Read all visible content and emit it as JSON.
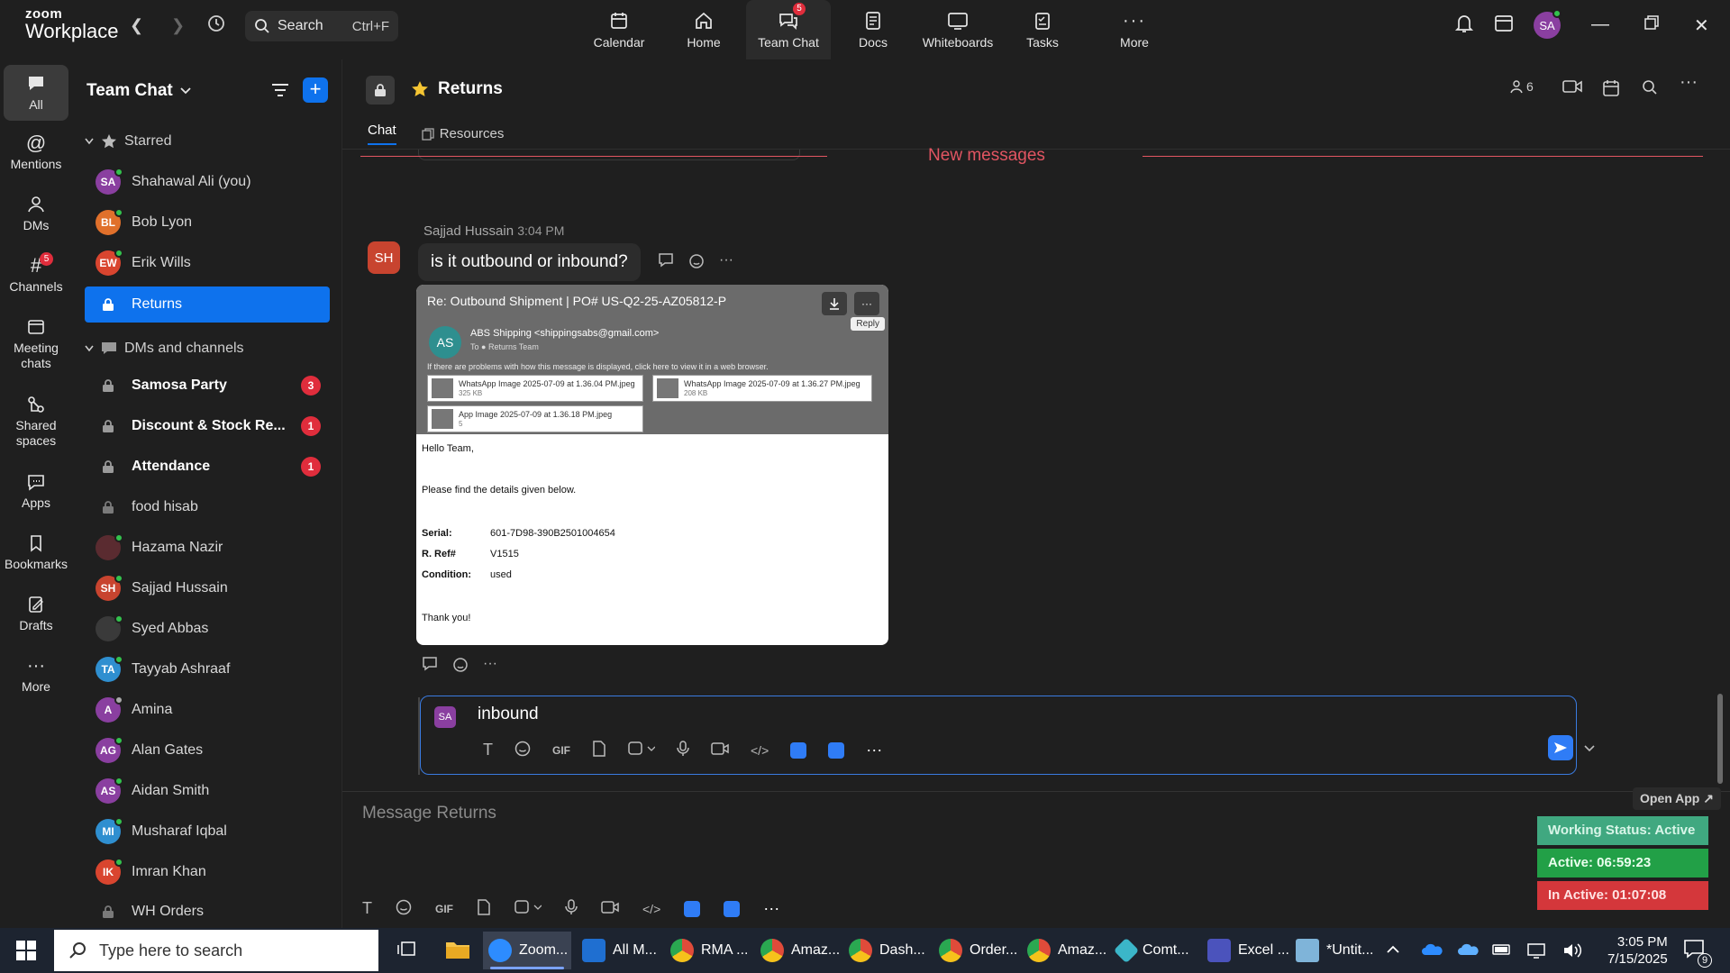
{
  "brand": {
    "line1": "zoom",
    "line2": "Workplace"
  },
  "search": {
    "label": "Search",
    "shortcut": "Ctrl+F"
  },
  "nav": [
    {
      "label": "Calendar",
      "icon": "calendar-icon"
    },
    {
      "label": "Home",
      "icon": "home-icon"
    },
    {
      "label": "Team Chat",
      "icon": "team-chat-icon",
      "badge": "5",
      "active": true
    },
    {
      "label": "Docs",
      "icon": "docs-icon"
    },
    {
      "label": "Whiteboards",
      "icon": "whiteboard-icon"
    },
    {
      "label": "Tasks",
      "icon": "tasks-icon"
    },
    {
      "label": "More",
      "icon": "more-icon"
    }
  ],
  "user": {
    "initials": "SA",
    "status_color": "#33c24d"
  },
  "rail": [
    {
      "label": "All",
      "icon": "chat-bubble-icon",
      "active": true
    },
    {
      "label": "Mentions",
      "icon": "at-icon"
    },
    {
      "label": "DMs",
      "icon": "people-icon"
    },
    {
      "label": "Channels",
      "icon": "hash-icon",
      "badge": "5"
    },
    {
      "label": "Meeting chats",
      "icon": "meeting-chat-icon"
    },
    {
      "label": "Shared spaces",
      "icon": "shared-spaces-icon"
    },
    {
      "label": "Apps",
      "icon": "apps-icon"
    },
    {
      "label": "Bookmarks",
      "icon": "bookmark-icon"
    },
    {
      "label": "Drafts",
      "icon": "drafts-icon"
    },
    {
      "label": "More",
      "icon": "more-icon"
    }
  ],
  "sidebar": {
    "title": "Team Chat",
    "starred_label": "Starred",
    "dms_label": "DMs and channels",
    "starred": [
      {
        "name": "Shahawal Ali (you)",
        "initials": "SA",
        "color": "#8a3fa0",
        "online": true
      },
      {
        "name": "Bob Lyon",
        "initials": "BL",
        "color": "#e0702b",
        "online": true
      },
      {
        "name": "Erik Wills",
        "initials": "EW",
        "color": "#d9452f",
        "online": true
      },
      {
        "name": "Returns",
        "initials": "",
        "lock": true,
        "selected": true
      }
    ],
    "channels": [
      {
        "name": "Samosa Party",
        "lock": true,
        "bold": true,
        "unread": "3"
      },
      {
        "name": "Discount & Stock Re...",
        "lock": true,
        "bold": true,
        "unread": "1"
      },
      {
        "name": "Attendance",
        "lock": true,
        "bold": true,
        "unread": "1"
      },
      {
        "name": "food hisab",
        "lock": true
      },
      {
        "name": "Hazama Nazir",
        "initials": "",
        "color": "#5a2b30",
        "online": true,
        "photo": true
      },
      {
        "name": "Sajjad Hussain",
        "initials": "SH",
        "color": "#c8442f",
        "online": true
      },
      {
        "name": "Syed Abbas",
        "initials": "",
        "color": "#3a3a3a",
        "online": true,
        "photo": true
      },
      {
        "name": "Tayyab Ashraaf",
        "initials": "TA",
        "color": "#2f8fd0",
        "online": true
      },
      {
        "name": "Amina",
        "initials": "A",
        "color": "#8a3fa0",
        "online": false
      },
      {
        "name": "Alan Gates",
        "initials": "AG",
        "color": "#8a3fa0",
        "online": true
      },
      {
        "name": "Aidan Smith",
        "initials": "AS",
        "color": "#8a3fa0",
        "online": true
      },
      {
        "name": "Musharaf Iqbal",
        "initials": "MI",
        "color": "#2f8fd0",
        "online": true
      },
      {
        "name": "Imran Khan",
        "initials": "IK",
        "color": "#d9452f",
        "online": true
      },
      {
        "name": "WH Orders",
        "lock": true
      }
    ]
  },
  "channel": {
    "title": "Returns",
    "tabs": [
      "Chat",
      "Resources"
    ],
    "member_count": "6",
    "new_messages": "New messages"
  },
  "message": {
    "sender": "Sajjad Hussain",
    "time": "3:04 PM",
    "initials": "SH",
    "text": "is it outbound or inbound?",
    "attachment": {
      "subject": "Re: Outbound Shipment | PO# US-Q2-25-AZ05812-P",
      "sender_initials": "AS",
      "from": "ABS Shipping <shippingsabs@gmail.com>",
      "to_label": "To",
      "to": "Returns Team",
      "reply": "Reply",
      "warning": "If there are problems with how this message is displayed, click here to view it in a web browser.",
      "files": [
        {
          "name": "WhatsApp Image 2025-07-09 at 1.36.04 PM.jpeg",
          "size": "325 KB"
        },
        {
          "name": "WhatsApp Image 2025-07-09 at 1.36.27 PM.jpeg",
          "size": "208 KB"
        },
        {
          "name": "App Image 2025-07-09 at 1.36.18 PM.jpeg",
          "size": "5"
        }
      ],
      "greeting": "Hello Team,",
      "intro": "Please find the details given below.",
      "fields": [
        {
          "label": "Serial:",
          "value": "601-7D98-390B2501004654"
        },
        {
          "label": "R. Ref#",
          "value": "V1515"
        },
        {
          "label": "Condition:",
          "value": "used"
        }
      ],
      "closing": "Thank you!"
    }
  },
  "reply": {
    "initials": "SA",
    "text": "inbound"
  },
  "composer": {
    "placeholder": "Message Returns",
    "gif": "GIF"
  },
  "widget": {
    "open_app": "Open App ↗",
    "working_status": "Working Status: Active",
    "active": "Active: 06:59:23",
    "inactive": "In Active: 01:07:08"
  },
  "taskbar": {
    "search_placeholder": "Type here to search",
    "apps": [
      {
        "label": "Zoom...",
        "color": "#2d8cff",
        "active": true
      },
      {
        "label": "All M...",
        "color": "#1f6fd1"
      },
      {
        "label": "RMA ...",
        "color": "#e04b3a"
      },
      {
        "label": "Amaz...",
        "color": "#e04b3a"
      },
      {
        "label": "Dash...",
        "color": "#e04b3a"
      },
      {
        "label": "Order...",
        "color": "#e04b3a"
      },
      {
        "label": "Amaz...",
        "color": "#e04b3a"
      },
      {
        "label": "Comt...",
        "color": "#3bb6c9"
      },
      {
        "label": "Excel ...",
        "color": "#4b53bc"
      },
      {
        "label": "*Untit...",
        "color": "#7fb4d9"
      }
    ],
    "time": "3:05 PM",
    "date": "7/15/2025",
    "notif_count": "9"
  }
}
